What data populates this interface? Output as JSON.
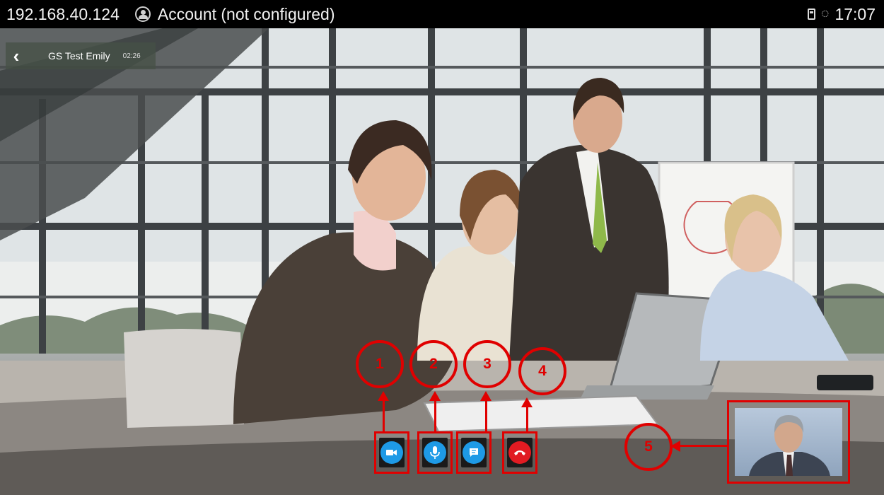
{
  "status_bar": {
    "ip": "192.168.40.124",
    "account": "Account (not configured)",
    "time": "17:07"
  },
  "call": {
    "name": "GS Test Emily",
    "duration": "02:26"
  },
  "controls": [
    {
      "icon": "video-camera-icon",
      "color": "#1e9ae6"
    },
    {
      "icon": "microphone-icon",
      "color": "#1e9ae6"
    },
    {
      "icon": "chat-icon",
      "color": "#1e9ae6"
    },
    {
      "icon": "hang-up-icon",
      "color": "#e11b22"
    }
  ],
  "callouts": [
    "1",
    "2",
    "3",
    "4",
    "5"
  ],
  "annotation_color": "#e00000"
}
